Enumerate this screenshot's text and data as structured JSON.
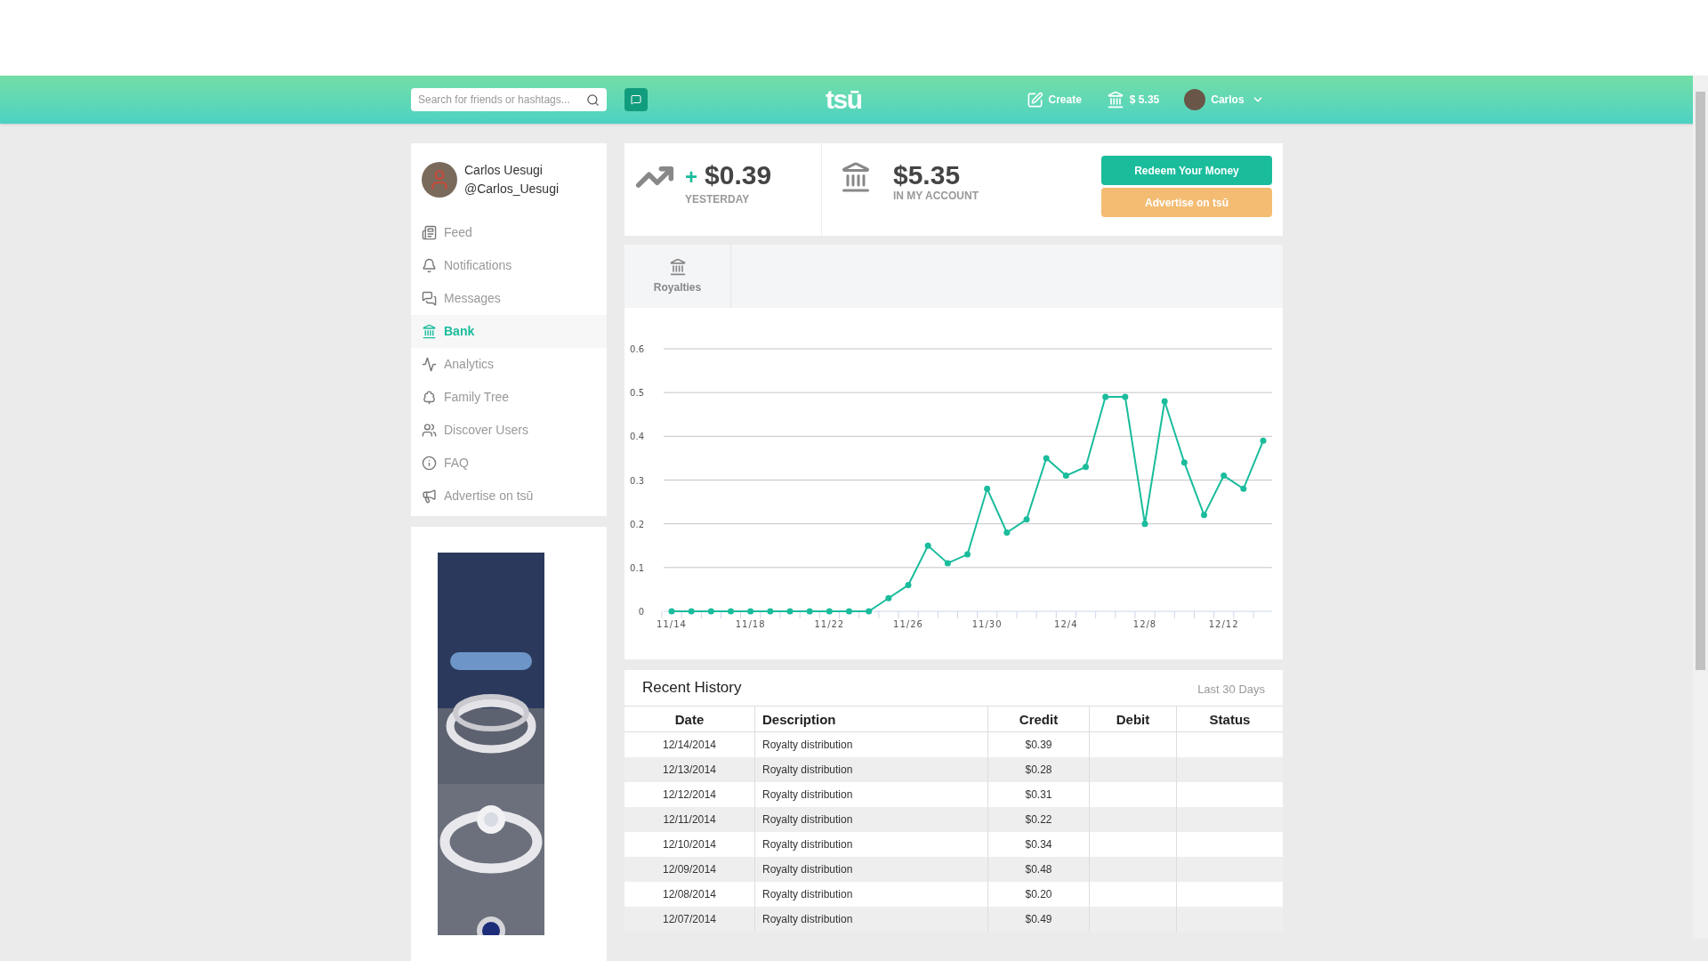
{
  "header": {
    "search": {
      "placeholder": "Search for friends or hashtags..."
    },
    "logo": "tsū",
    "create": "Create",
    "balance": "$ 5.35",
    "user": "Carlos"
  },
  "profile": {
    "name": "Carlos Uesugi",
    "handle": "@Carlos_Uesugi"
  },
  "nav": [
    {
      "label": "Feed",
      "kind": "feed",
      "selected": false
    },
    {
      "label": "Notifications",
      "kind": "bell",
      "selected": false
    },
    {
      "label": "Messages",
      "kind": "messages",
      "selected": false
    },
    {
      "label": "Bank",
      "kind": "bank",
      "selected": true
    },
    {
      "label": "Analytics",
      "kind": "analytics",
      "selected": false
    },
    {
      "label": "Family Tree",
      "kind": "tree",
      "selected": false
    },
    {
      "label": "Discover Users",
      "kind": "users",
      "selected": false
    },
    {
      "label": "FAQ",
      "kind": "info",
      "selected": false
    },
    {
      "label": "Advertise on tsū",
      "kind": "megaphone",
      "selected": false
    }
  ],
  "stats": [
    {
      "kind": "trend",
      "prefix": "+",
      "value": "$0.39",
      "label": "YESTERDAY"
    },
    {
      "kind": "bank",
      "value": "$5.35",
      "label": "IN MY ACCOUNT"
    }
  ],
  "actions": [
    {
      "kind": "primary",
      "label": "Redeem Your Money"
    },
    {
      "kind": "secondary",
      "label": "Advertise on tsū"
    }
  ],
  "tabs": [
    {
      "label": "Royalties"
    }
  ],
  "chart_data": {
    "type": "line",
    "categories": [
      "11/14",
      null,
      null,
      null,
      "11/18",
      null,
      null,
      null,
      "11/22",
      null,
      null,
      null,
      "11/26",
      null,
      null,
      null,
      "11/30",
      null,
      null,
      null,
      "12/4",
      null,
      null,
      null,
      "12/8",
      null,
      null,
      null,
      "12/12",
      null,
      null
    ],
    "grid": true,
    "series": [
      {
        "color": "#1abc9c",
        "marker": true,
        "values": [
          0,
          0,
          0,
          0,
          0,
          0,
          0,
          0,
          0,
          0,
          0,
          0.03,
          0.06,
          0.15,
          0.11,
          0.13,
          0.28,
          0.18,
          0.21,
          0.35,
          0.31,
          0.33,
          0.49,
          0.49,
          0.2,
          0.48,
          0.34,
          0.22,
          0.31,
          0.28,
          0.39
        ]
      }
    ],
    "ylim": [
      0,
      0.6
    ],
    "yticks": [
      0,
      0.1,
      0.2,
      0.3,
      0.4,
      0.5,
      0.6
    ]
  },
  "history": {
    "title": "Recent History",
    "period": "Last 30 Days",
    "columns": [
      "Date",
      "Description",
      "Credit",
      "Debit",
      "Status"
    ],
    "rows": [
      {
        "date": "12/14/2014",
        "description": "Royalty distribution",
        "credit": "$0.39"
      },
      {
        "date": "12/13/2014",
        "description": "Royalty distribution",
        "credit": "$0.28"
      },
      {
        "date": "12/12/2014",
        "description": "Royalty distribution",
        "credit": "$0.31"
      },
      {
        "date": "12/11/2014",
        "description": "Royalty distribution",
        "credit": "$0.22"
      },
      {
        "date": "12/10/2014",
        "description": "Royalty distribution",
        "credit": "$0.34"
      },
      {
        "date": "12/09/2014",
        "description": "Royalty distribution",
        "credit": "$0.48"
      },
      {
        "date": "12/08/2014",
        "description": "Royalty distribution",
        "credit": "$0.20"
      },
      {
        "date": "12/07/2014",
        "description": "Royalty distribution",
        "credit": "$0.49"
      }
    ]
  }
}
